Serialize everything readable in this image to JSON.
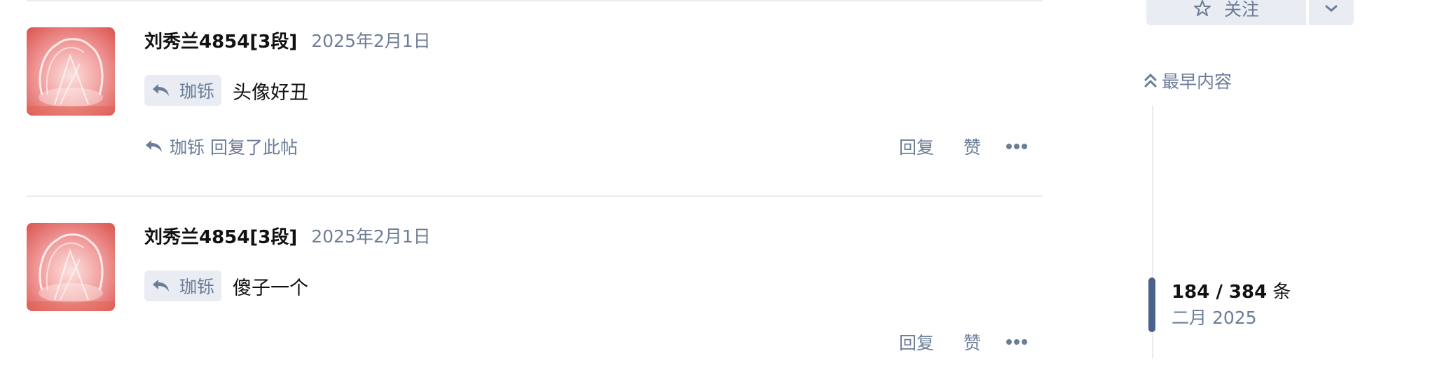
{
  "posts": [
    {
      "username": "刘秀兰4854[3段]",
      "date": "2025年2月1日",
      "reply_to": "珈铄",
      "body": "头像好丑",
      "replied_line": "珈铄 回复了此帖",
      "actions": {
        "reply": "回复",
        "like": "赞"
      }
    },
    {
      "username": "刘秀兰4854[3段]",
      "date": "2025年2月1日",
      "reply_to": "珈铄",
      "body": "傻子一个",
      "actions": {
        "reply": "回复",
        "like": "赞"
      }
    }
  ],
  "sidebar": {
    "follow_label": "关注",
    "earliest_label": "最早内容",
    "timeline": {
      "current": "184",
      "separator": " / ",
      "total": "384",
      "unit": " 条",
      "date": "二月 2025",
      "position_fraction": 0.479
    }
  },
  "colors": {
    "muted": "#6b7d98",
    "tag_bg": "#e9edf3",
    "divider": "#e9ebef",
    "timeline_handle": "#4a628a"
  },
  "icons": {
    "reply": "reply-arrow-icon",
    "more": "ellipsis-icon",
    "star": "star-icon",
    "chevron": "chevron-down-icon",
    "earliest": "double-chevron-up-icon"
  }
}
